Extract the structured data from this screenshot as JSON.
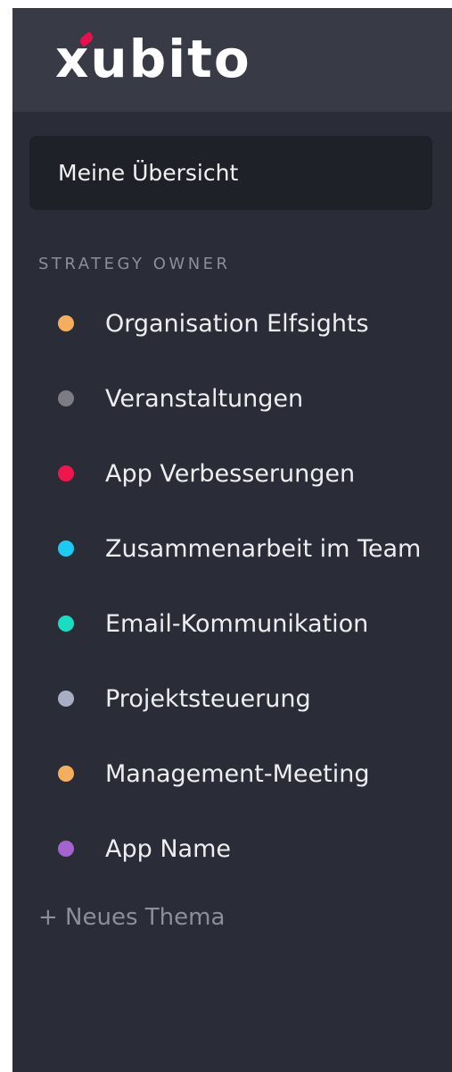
{
  "brand": {
    "logo_text": "xubito"
  },
  "overview": {
    "label": "Meine Übersicht"
  },
  "section": {
    "label": "STRATEGY OWNER"
  },
  "topics": [
    {
      "label": "Organisation Elfsights",
      "color": "#f5ae5c"
    },
    {
      "label": "Veranstaltungen",
      "color": "#7d7c84"
    },
    {
      "label": "App Verbesserungen",
      "color": "#f0154f"
    },
    {
      "label": "Zusammenarbeit im Team",
      "color": "#1ccaf2"
    },
    {
      "label": "Email-Kommunikation",
      "color": "#19dcc0"
    },
    {
      "label": "Projektsteuerung",
      "color": "#a8aec3"
    },
    {
      "label": "Management-Meeting",
      "color": "#f5ae5c"
    },
    {
      "label": "App Name",
      "color": "#a563cf"
    }
  ],
  "actions": {
    "new_topic_label": "+ Neues Thema"
  }
}
